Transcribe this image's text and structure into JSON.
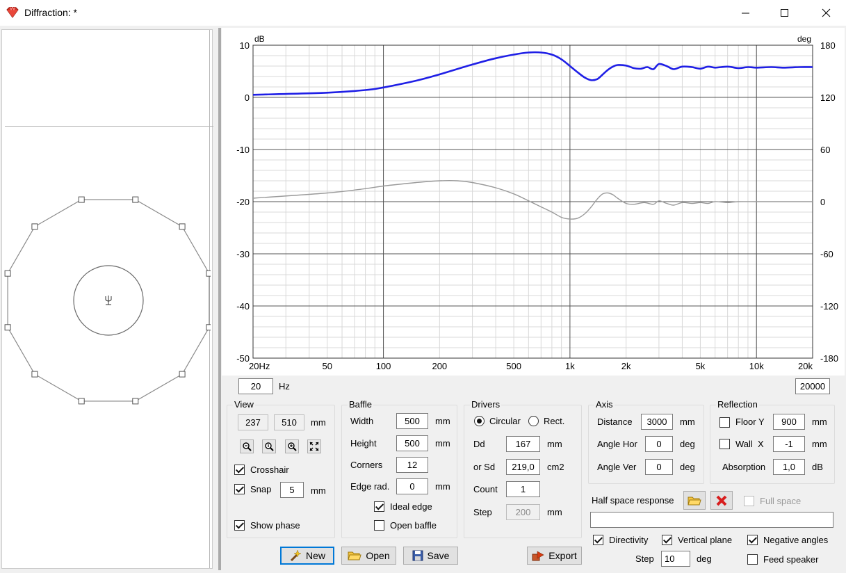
{
  "window": {
    "title": "Diffraction: *"
  },
  "chart": {
    "freq_min": "20",
    "freq_unit": "Hz",
    "freq_max": "20000"
  },
  "chart_data": {
    "type": "line",
    "xscale": "log",
    "xlim": [
      20,
      20000
    ],
    "ylim": [
      -50,
      10
    ],
    "y2lim": [
      -180,
      180
    ],
    "ylabel": "dB",
    "y2label": "deg",
    "x_ticks": [
      [
        20,
        "20Hz"
      ],
      [
        50,
        "50"
      ],
      [
        100,
        "100"
      ],
      [
        200,
        "200"
      ],
      [
        500,
        "500"
      ],
      [
        1000,
        "1k"
      ],
      [
        2000,
        "2k"
      ],
      [
        5000,
        "5k"
      ],
      [
        10000,
        "10k"
      ],
      [
        20000,
        "20k"
      ]
    ],
    "y_ticks": [
      10,
      0,
      -10,
      -20,
      -30,
      -40,
      -50
    ],
    "y2_ticks": [
      180,
      120,
      60,
      0,
      -60,
      -120,
      -180
    ],
    "grid": true,
    "series": [
      {
        "axis": "left",
        "color": "#1f1fe6",
        "x": [
          20,
          50,
          80,
          100,
          150,
          200,
          300,
          400,
          500,
          600,
          700,
          800,
          900,
          1000,
          1100,
          1200,
          1300,
          1400,
          1500,
          1600,
          1700,
          1800,
          2000,
          2200,
          2400,
          2600,
          2800,
          3000,
          3300,
          3600,
          4000,
          4500,
          5000,
          5500,
          6000,
          7000,
          8000,
          9000,
          10000,
          12000,
          14000,
          17000,
          20000
        ],
        "values": [
          0.5,
          0.9,
          1.4,
          1.9,
          3.2,
          4.4,
          6.3,
          7.5,
          8.2,
          8.6,
          8.6,
          8.2,
          7.3,
          6.0,
          4.8,
          3.8,
          3.3,
          3.5,
          4.4,
          5.3,
          5.9,
          6.2,
          6.1,
          5.6,
          5.5,
          5.8,
          5.4,
          6.4,
          6.0,
          5.4,
          5.9,
          5.8,
          5.5,
          5.9,
          5.7,
          5.9,
          5.6,
          5.8,
          5.7,
          5.8,
          5.7,
          5.8,
          5.8
        ]
      },
      {
        "axis": "right",
        "color": "#9a9a9a",
        "x": [
          20,
          50,
          80,
          100,
          150,
          200,
          250,
          300,
          400,
          500,
          600,
          700,
          800,
          900,
          1000,
          1100,
          1200,
          1300,
          1400,
          1500,
          1600,
          1700,
          1800,
          2000,
          2200,
          2500,
          2800,
          3000,
          3300,
          3600,
          4000,
          4500,
          5000,
          5500,
          6000,
          7000,
          8000,
          10000,
          12000,
          15000,
          20000
        ],
        "values": [
          4,
          10,
          15,
          18,
          22,
          24,
          24,
          22,
          16,
          9,
          1,
          -6,
          -12,
          -18,
          -20,
          -19,
          -14,
          -6,
          3,
          9,
          10,
          8,
          4,
          -2,
          -3,
          -1,
          -3,
          1,
          -2,
          -4,
          -1,
          -2,
          -1,
          -2,
          0,
          -1,
          0,
          0,
          0,
          0,
          0
        ]
      }
    ]
  },
  "left_panel": {
    "baffle_colors": {
      "outline": "#8a8a8a",
      "driver": "#6a6a6a"
    },
    "driver_icon": "microphone-icon"
  },
  "view": {
    "title": "View",
    "x": "237",
    "y": "510",
    "unit": "mm",
    "crosshair": "Crosshair",
    "snap": "Snap",
    "snap_value": "5",
    "snap_unit": "mm",
    "show_phase": "Show phase"
  },
  "baffle": {
    "title": "Baffle",
    "width_label": "Width",
    "width": "500",
    "width_unit": "mm",
    "height_label": "Height",
    "height": "500",
    "height_unit": "mm",
    "corners_label": "Corners",
    "corners": "12",
    "edge_label": "Edge rad.",
    "edge": "0",
    "edge_unit": "mm",
    "ideal_edge": "Ideal edge",
    "open_baffle": "Open baffle"
  },
  "drivers": {
    "title": "Drivers",
    "circular": "Circular",
    "rect": "Rect.",
    "dd_label": "Dd",
    "dd": "167",
    "dd_unit": "mm",
    "sd_label": "or Sd",
    "sd": "219,0",
    "sd_unit": "cm2",
    "count_label": "Count",
    "count": "1",
    "step_label": "Step",
    "step": "200",
    "step_unit": "mm"
  },
  "axis": {
    "title": "Axis",
    "distance_label": "Distance",
    "distance": "3000",
    "distance_unit": "mm",
    "hor_label": "Angle Hor",
    "hor": "0",
    "hor_unit": "deg",
    "ver_label": "Angle Ver",
    "ver": "0",
    "ver_unit": "deg"
  },
  "reflection": {
    "title": "Reflection",
    "floor_label": "Floor Y",
    "floor": "900",
    "floor_unit": "mm",
    "wall_label": "Wall  X",
    "wall": "-1",
    "wall_unit": "mm",
    "absorption_label": "Absorption",
    "absorption": "1,0",
    "absorption_unit": "dB"
  },
  "half_space": {
    "label": "Half space response",
    "full_space": "Full space",
    "path": ""
  },
  "bottom": {
    "directivity": "Directivity",
    "vertical_plane": "Vertical plane",
    "negative_angles": "Negative angles",
    "step_label": "Step",
    "step": "10",
    "step_unit": "deg",
    "feed_speaker": "Feed speaker"
  },
  "buttons": {
    "new": "New",
    "open": "Open",
    "save": "Save",
    "export": "Export"
  }
}
